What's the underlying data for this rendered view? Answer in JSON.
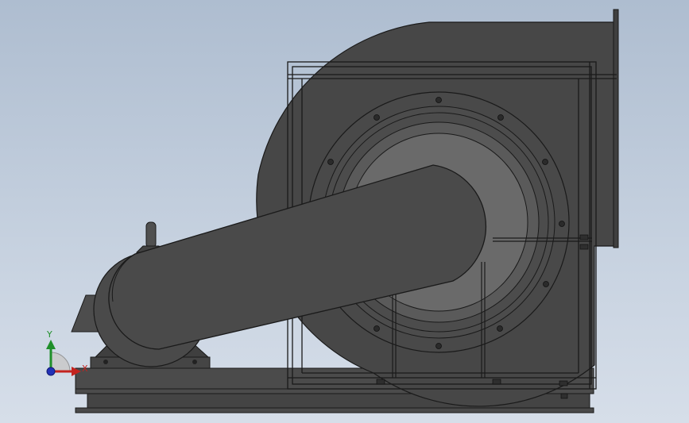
{
  "viewport": {
    "background_top": "#aebdd0",
    "background_bottom": "#d6dee9"
  },
  "model": {
    "description_icon": "centrifugal-fan-assembly",
    "body_color": "#4a4a4a",
    "edge_color": "#1a1a1a",
    "highlight_color": "#5c5c5c",
    "inlet_shade": "#6a6a6a"
  },
  "triad": {
    "y_label": "Y",
    "x_label": "X",
    "y_color": "#1f8f2a",
    "x_color": "#c3231f",
    "z_color": "#2231b8"
  }
}
